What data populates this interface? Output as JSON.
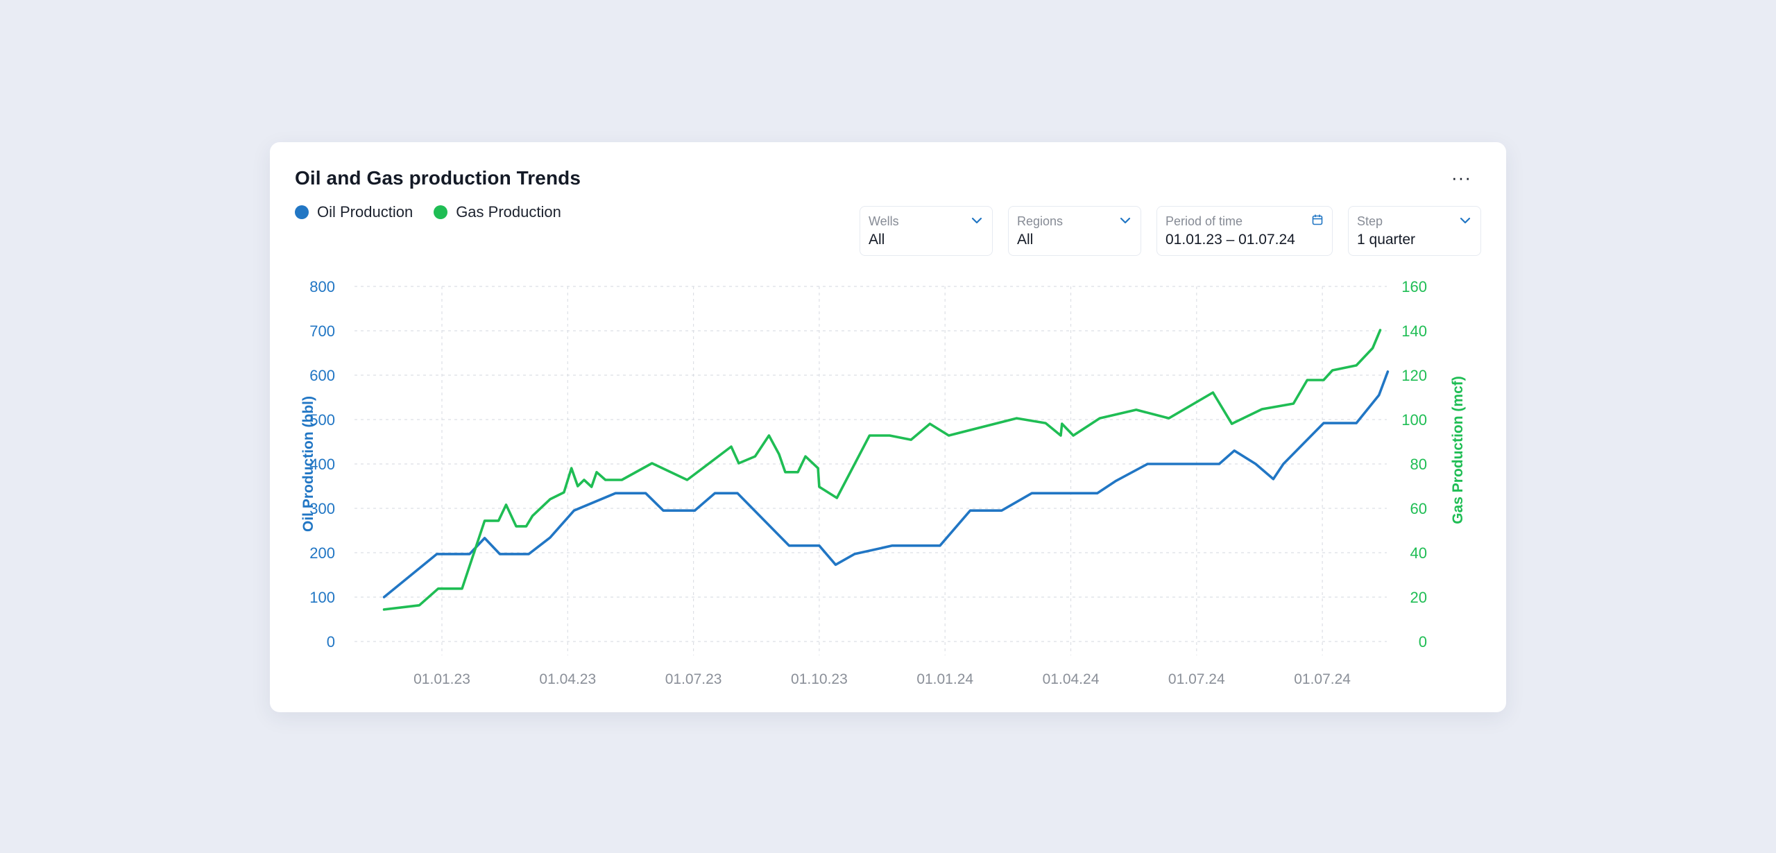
{
  "card": {
    "title": "Oil and Gas production Trends",
    "more_icon": "more-horizontal-icon",
    "more_label": "···"
  },
  "legend": [
    {
      "label": "Oil Production",
      "color": "#2176c4"
    },
    {
      "label": "Gas Production",
      "color": "#1fbd54"
    }
  ],
  "filters": [
    {
      "label": "Wells",
      "value": "All",
      "icon": "chevron-down-icon"
    },
    {
      "label": "Regions",
      "value": "All",
      "icon": "chevron-down-icon"
    },
    {
      "label": "Period of time",
      "value": "01.01.23 – 01.07.24",
      "icon": "calendar-icon"
    },
    {
      "label": "Step",
      "value": "1 quarter",
      "icon": "chevron-down-icon"
    }
  ],
  "colors": {
    "oil": "#2176c4",
    "gas": "#1fbd54",
    "grid": "#dcdfe5",
    "xtick": "#8a8f98",
    "accent": "#2176c4"
  },
  "chart_data": {
    "type": "line",
    "title": "Oil and Gas production Trends",
    "x_unit": "quarter index (0 = 01.01.23, 1 = one quarter)",
    "x_tick_labels": [
      "01.01.23",
      "01.04.23",
      "01.07.23",
      "01.10.23",
      "01.01.24",
      "01.04.24",
      "01.07.24",
      "01.07.24"
    ],
    "x_tick_positions": [
      0,
      1,
      2,
      3,
      4,
      5,
      6,
      7
    ],
    "xlim": [
      -0.5,
      7.55
    ],
    "y_left": {
      "label": "Oil Production (bbl)",
      "range": [
        0,
        800
      ],
      "ticks": [
        0,
        100,
        200,
        300,
        400,
        500,
        600,
        700,
        800
      ]
    },
    "y_right": {
      "label": "Gas Production (mcf)",
      "range": [
        0,
        160
      ],
      "ticks": [
        0,
        20,
        40,
        60,
        80,
        100,
        120,
        140,
        160
      ]
    },
    "grid": true,
    "legend_position": "top-left",
    "series": [
      {
        "name": "Oil Production",
        "axis": "left",
        "x": [
          -0.46,
          -0.04,
          0.22,
          0.34,
          0.46,
          0.69,
          0.86,
          1.05,
          1.38,
          1.62,
          1.76,
          2.01,
          2.17,
          2.35,
          2.76,
          3.0,
          3.13,
          3.28,
          3.58,
          3.96,
          4.2,
          4.45,
          4.69,
          5.21,
          5.36,
          5.61,
          6.18,
          6.3,
          6.47,
          6.61,
          6.69,
          7.01,
          7.27,
          7.45,
          7.52
        ],
        "y": [
          100,
          197,
          197,
          233,
          197,
          197,
          234,
          295,
          334,
          334,
          295,
          295,
          334,
          334,
          216,
          216,
          173,
          197,
          216,
          216,
          295,
          295,
          334,
          334,
          362,
          400,
          400,
          430,
          400,
          366,
          400,
          492,
          492,
          555,
          608
        ]
      },
      {
        "name": "Gas Production",
        "axis": "right",
        "x": [
          -0.46,
          -0.18,
          -0.03,
          0.16,
          0.34,
          0.45,
          0.51,
          0.59,
          0.67,
          0.72,
          0.86,
          0.97,
          1.03,
          1.08,
          1.13,
          1.19,
          1.23,
          1.3,
          1.43,
          1.67,
          1.95,
          2.3,
          2.36,
          2.49,
          2.6,
          2.68,
          2.73,
          2.83,
          2.89,
          2.99,
          3.0,
          3.14,
          3.4,
          3.56,
          3.73,
          3.88,
          4.03,
          4.57,
          4.8,
          4.92,
          4.93,
          5.02,
          5.23,
          5.52,
          5.78,
          6.13,
          6.28,
          6.52,
          6.77,
          6.88,
          7.01,
          7.08,
          7.27,
          7.4,
          7.46
        ],
        "y": [
          14.4,
          16.3,
          23.8,
          23.8,
          54.4,
          54.4,
          61.6,
          51.9,
          51.9,
          56.6,
          64.1,
          67.2,
          78.1,
          70.0,
          72.8,
          69.7,
          76.3,
          72.8,
          72.8,
          80.3,
          72.8,
          87.8,
          80.3,
          83.4,
          92.8,
          84.4,
          76.3,
          76.3,
          83.4,
          78.1,
          69.7,
          64.7,
          92.8,
          92.8,
          90.9,
          98.1,
          92.8,
          100.6,
          98.4,
          92.8,
          98.1,
          92.8,
          100.6,
          104.4,
          100.6,
          112.2,
          98.1,
          104.7,
          107.2,
          117.8,
          117.8,
          122.2,
          124.4,
          132.2,
          140.3
        ]
      }
    ]
  }
}
